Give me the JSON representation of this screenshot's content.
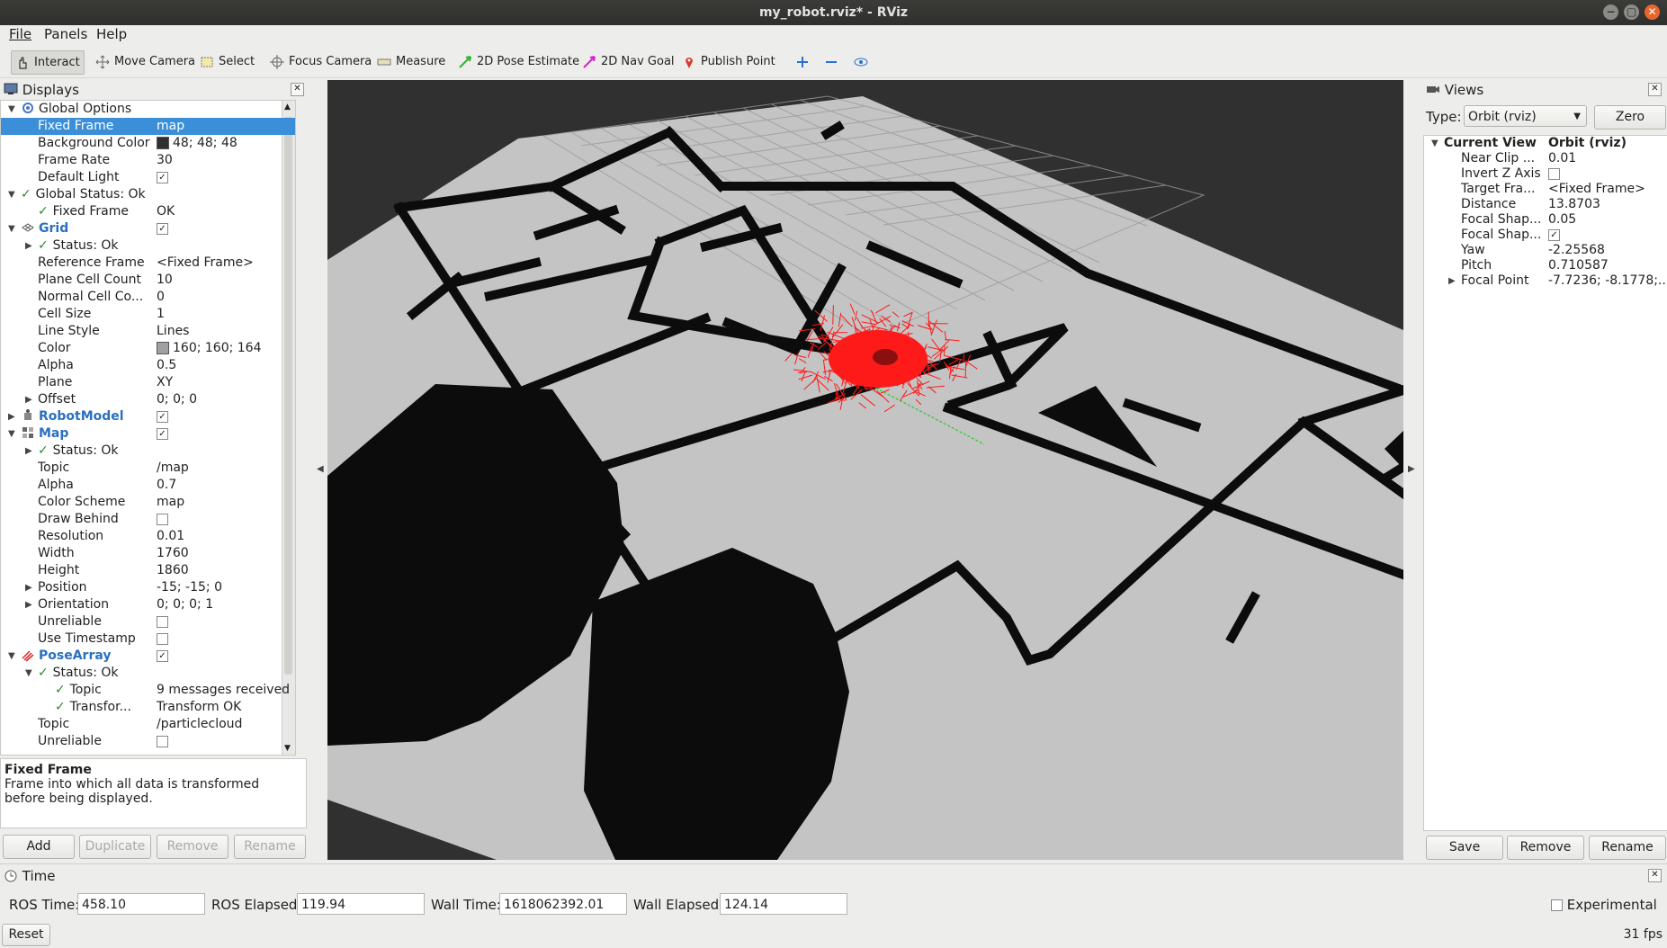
{
  "window": {
    "title": "my_robot.rviz* - RViz",
    "buttons": [
      "−",
      "▢",
      "✕"
    ]
  },
  "menu": [
    "File",
    "Panels",
    "Help"
  ],
  "toolbar": [
    {
      "label": "Interact",
      "icon": "hand-cursor-icon",
      "active": true
    },
    {
      "label": "Move Camera",
      "icon": "move-camera-icon"
    },
    {
      "label": "Select",
      "icon": "select-box-icon"
    },
    {
      "label": "Focus Camera",
      "icon": "focus-camera-icon"
    },
    {
      "label": "Measure",
      "icon": "ruler-icon"
    },
    {
      "label": "2D Pose Estimate",
      "icon": "pose-estimate-arrow-icon"
    },
    {
      "label": "2D Nav Goal",
      "icon": "nav-goal-arrow-icon"
    },
    {
      "label": "Publish Point",
      "icon": "map-pin-icon"
    }
  ],
  "displays": {
    "title": "Displays",
    "rows": [
      {
        "indent": 0,
        "arrow": "down",
        "icon": "gear",
        "key": "Global Options",
        "val": ""
      },
      {
        "indent": 1,
        "key": "Fixed Frame",
        "val": "map",
        "selected": true
      },
      {
        "indent": 1,
        "key": "Background Color",
        "val": "48; 48; 48",
        "swatch": "#303030"
      },
      {
        "indent": 1,
        "key": "Frame Rate",
        "val": "30"
      },
      {
        "indent": 1,
        "key": "Default Light",
        "check": true
      },
      {
        "indent": 0,
        "arrow": "down",
        "tick": true,
        "key": "Global Status: Ok",
        "val": ""
      },
      {
        "indent": 1,
        "tick": true,
        "key": "Fixed Frame",
        "val": "OK"
      },
      {
        "indent": 0,
        "arrow": "down",
        "icon": "grid",
        "key": "Grid",
        "bold": true,
        "check": true
      },
      {
        "indent": 1,
        "arrow": "right",
        "tick": true,
        "key": "Status: Ok",
        "val": ""
      },
      {
        "indent": 1,
        "key": "Reference Frame",
        "val": "<Fixed Frame>"
      },
      {
        "indent": 1,
        "key": "Plane Cell Count",
        "val": "10"
      },
      {
        "indent": 1,
        "key": "Normal Cell Co...",
        "val": "0"
      },
      {
        "indent": 1,
        "key": "Cell Size",
        "val": "1"
      },
      {
        "indent": 1,
        "key": "Line Style",
        "val": "Lines"
      },
      {
        "indent": 1,
        "key": "Color",
        "val": "160; 160; 164",
        "swatch": "#a0a0a4"
      },
      {
        "indent": 1,
        "key": "Alpha",
        "val": "0.5"
      },
      {
        "indent": 1,
        "key": "Plane",
        "val": "XY"
      },
      {
        "indent": 1,
        "arrow": "right",
        "key": "Offset",
        "val": "0; 0; 0"
      },
      {
        "indent": 0,
        "arrow": "right",
        "icon": "robot",
        "key": "RobotModel",
        "bold": true,
        "check": true
      },
      {
        "indent": 0,
        "arrow": "down",
        "icon": "map",
        "key": "Map",
        "bold": true,
        "check": true
      },
      {
        "indent": 1,
        "arrow": "right",
        "tick": true,
        "key": "Status: Ok",
        "val": ""
      },
      {
        "indent": 1,
        "key": "Topic",
        "val": "/map"
      },
      {
        "indent": 1,
        "key": "Alpha",
        "val": "0.7"
      },
      {
        "indent": 1,
        "key": "Color Scheme",
        "val": "map"
      },
      {
        "indent": 1,
        "key": "Draw Behind",
        "check": false
      },
      {
        "indent": 1,
        "key": "Resolution",
        "val": "0.01"
      },
      {
        "indent": 1,
        "key": "Width",
        "val": "1760"
      },
      {
        "indent": 1,
        "key": "Height",
        "val": "1860"
      },
      {
        "indent": 1,
        "arrow": "right",
        "key": "Position",
        "val": "-15; -15; 0"
      },
      {
        "indent": 1,
        "arrow": "right",
        "key": "Orientation",
        "val": "0; 0; 0; 1"
      },
      {
        "indent": 1,
        "key": "Unreliable",
        "check": false
      },
      {
        "indent": 1,
        "key": "Use Timestamp",
        "check": false
      },
      {
        "indent": 0,
        "arrow": "down",
        "icon": "posearray",
        "key": "PoseArray",
        "bold": true,
        "check": true
      },
      {
        "indent": 1,
        "arrow": "down",
        "tick": true,
        "key": "Status: Ok",
        "val": ""
      },
      {
        "indent": 2,
        "tick": true,
        "key": "Topic",
        "val": "9 messages received"
      },
      {
        "indent": 2,
        "tick": true,
        "key": "Transfor...",
        "val": "Transform OK"
      },
      {
        "indent": 1,
        "key": "Topic",
        "val": "/particlecloud"
      },
      {
        "indent": 1,
        "key": "Unreliable",
        "check": false
      }
    ],
    "description_title": "Fixed Frame",
    "description_text": "Frame into which all data is transformed before being displayed.",
    "buttons": [
      "Add",
      "Duplicate",
      "Remove",
      "Rename"
    ]
  },
  "views": {
    "title": "Views",
    "type_label": "Type:",
    "type_value": "Orbit (rviz)",
    "zero_label": "Zero",
    "rows": [
      {
        "indent": 0,
        "arrow": "down",
        "key": "Current View",
        "val": "Orbit (rviz)",
        "bold": true
      },
      {
        "indent": 1,
        "key": "Near Clip ...",
        "val": "0.01"
      },
      {
        "indent": 1,
        "key": "Invert Z Axis",
        "check": false
      },
      {
        "indent": 1,
        "key": "Target Fra...",
        "val": "<Fixed Frame>"
      },
      {
        "indent": 1,
        "key": "Distance",
        "val": "13.8703"
      },
      {
        "indent": 1,
        "key": "Focal Shap...",
        "val": "0.05"
      },
      {
        "indent": 1,
        "key": "Focal Shap...",
        "check": true
      },
      {
        "indent": 1,
        "key": "Yaw",
        "val": "-2.25568"
      },
      {
        "indent": 1,
        "key": "Pitch",
        "val": "0.710587"
      },
      {
        "indent": 1,
        "arrow": "right",
        "key": "Focal Point",
        "val": "-7.7236; -8.1778;..."
      }
    ],
    "buttons": [
      "Save",
      "Remove",
      "Rename"
    ]
  },
  "time": {
    "title": "Time",
    "ros_time_label": "ROS Time:",
    "ros_time": "458.10",
    "ros_elapsed_label": "ROS Elapsed:",
    "ros_elapsed": "119.94",
    "wall_time_label": "Wall Time:",
    "wall_time": "1618062392.01",
    "wall_elapsed_label": "Wall Elapsed:",
    "wall_elapsed": "124.14",
    "experimental_label": "Experimental",
    "reset_label": "Reset",
    "fps": "31 fps"
  },
  "colors": {
    "viewport_bg": "#303030",
    "floor": "#c4c4c4",
    "wall": "#0c0c0c",
    "particles": "#ff1a1a",
    "selection": "#3a8fd8"
  }
}
